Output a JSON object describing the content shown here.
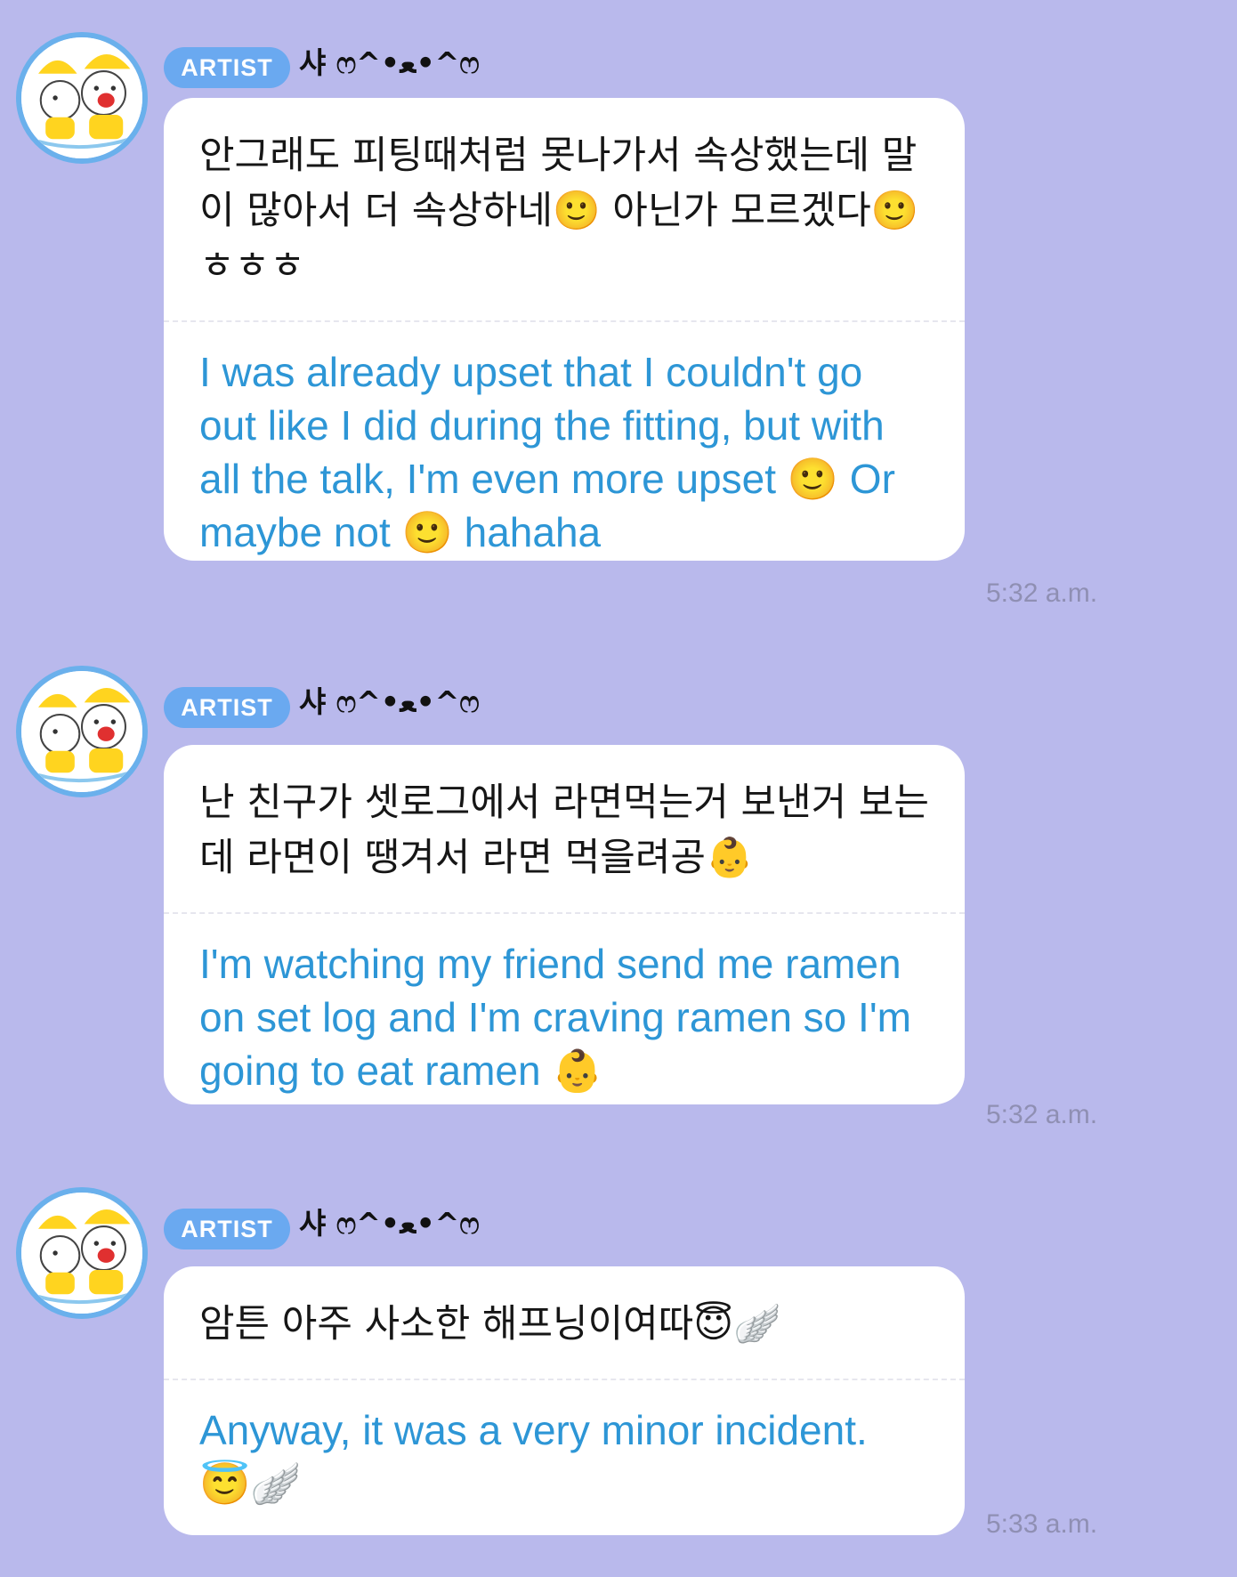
{
  "messages": [
    {
      "badge": "ARTIST",
      "sender": "샤 ෆ^•ﻌ•^ෆ",
      "original": "안그래도 피팅때처럼 못나가서 속상했는데 말이 많아서 더 속상하네🙂 아닌가 모르겠다🙂ㅎㅎㅎ",
      "translation": "I was already upset that I couldn't go out like I did during the fitting, but with all the talk, I'm even more upset 🙂 Or maybe not 🙂 hahaha",
      "time": "5:32 a.m."
    },
    {
      "badge": "ARTIST",
      "sender": "샤 ෆ^•ﻌ•^ෆ",
      "original": "난 친구가 셋로그에서 라면먹는거 보낸거 보는데 라면이 땡겨서 라면 먹을려공👶",
      "translation": "I'm watching my friend send me ramen on set log and I'm craving ramen so I'm going to eat ramen 👶",
      "time": "5:32 a.m."
    },
    {
      "badge": "ARTIST",
      "sender": "샤 ෆ^•ﻌ•^ෆ",
      "original": "암튼 아주 사소한 해프닝이여따😇🪽",
      "translation": "Anyway, it was a very minor incident. 😇🪽",
      "time": "5:33 a.m."
    }
  ]
}
